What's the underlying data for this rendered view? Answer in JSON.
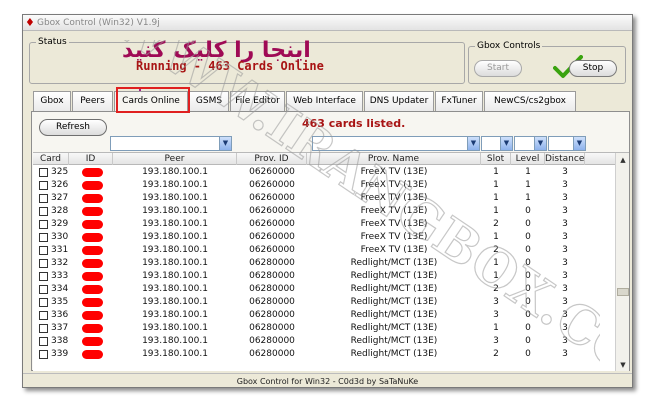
{
  "window": {
    "title": "Gbox Control (Win32) V1.9j"
  },
  "status_group": {
    "label": "Status",
    "running_text": "Running - 463 Cards Online"
  },
  "controls_group": {
    "label": "Gbox Controls",
    "start_label": "Start",
    "stop_label": "Stop"
  },
  "annotation": {
    "text": "اینجا را کلیک کنید"
  },
  "tabs": [
    {
      "label": "Gbox"
    },
    {
      "label": "Peers"
    },
    {
      "label": "Cards Online"
    },
    {
      "label": "GSMS"
    },
    {
      "label": "File Editor"
    },
    {
      "label": "Web Interface"
    },
    {
      "label": "DNS Updater"
    },
    {
      "label": "FxTuner"
    },
    {
      "label": "NewCS/cs2gbox"
    }
  ],
  "active_tab": "Cards Online",
  "cards_panel": {
    "refresh_label": "Refresh",
    "listed_text": "463 cards listed."
  },
  "table": {
    "columns": [
      "Card",
      "ID",
      "Peer",
      "Prov. ID",
      "Prov. Name",
      "Slot",
      "Level",
      "Distance"
    ],
    "rows": [
      [
        "325",
        "193.180.100.1",
        "06260000",
        "FreeX TV (13E)",
        "1",
        "1",
        "3"
      ],
      [
        "326",
        "193.180.100.1",
        "06260000",
        "FreeX TV (13E)",
        "1",
        "1",
        "3"
      ],
      [
        "327",
        "193.180.100.1",
        "06260000",
        "FreeX TV (13E)",
        "1",
        "1",
        "3"
      ],
      [
        "328",
        "193.180.100.1",
        "06260000",
        "FreeX TV (13E)",
        "1",
        "0",
        "3"
      ],
      [
        "329",
        "193.180.100.1",
        "06260000",
        "FreeX TV (13E)",
        "2",
        "0",
        "3"
      ],
      [
        "330",
        "193.180.100.1",
        "06260000",
        "FreeX TV (13E)",
        "1",
        "0",
        "3"
      ],
      [
        "331",
        "193.180.100.1",
        "06260000",
        "FreeX TV (13E)",
        "2",
        "0",
        "3"
      ],
      [
        "332",
        "193.180.100.1",
        "06280000",
        "Redlight/MCT (13E)",
        "1",
        "0",
        "3"
      ],
      [
        "333",
        "193.180.100.1",
        "06280000",
        "Redlight/MCT (13E)",
        "1",
        "0",
        "3"
      ],
      [
        "334",
        "193.180.100.1",
        "06280000",
        "Redlight/MCT (13E)",
        "2",
        "0",
        "3"
      ],
      [
        "335",
        "193.180.100.1",
        "06280000",
        "Redlight/MCT (13E)",
        "3",
        "0",
        "3"
      ],
      [
        "336",
        "193.180.100.1",
        "06280000",
        "Redlight/MCT (13E)",
        "3",
        "0",
        "3"
      ],
      [
        "337",
        "193.180.100.1",
        "06280000",
        "Redlight/MCT (13E)",
        "1",
        "0",
        "3"
      ],
      [
        "338",
        "193.180.100.1",
        "06280000",
        "Redlight/MCT (13E)",
        "3",
        "0",
        "3"
      ],
      [
        "339",
        "193.180.100.1",
        "06280000",
        "Redlight/MCT (13E)",
        "2",
        "0",
        "3"
      ]
    ]
  },
  "statusbar": {
    "text": "Gbox Control for Win32 - C0d3d by SaTaNuKe"
  },
  "watermark": {
    "text": "WWW.IRANGBOX.COM"
  },
  "colors": {
    "accent_red": "#a81414",
    "highlight_box": "#e02020",
    "annotation": "#9f0a55",
    "check_green": "#3aa30f",
    "id_mask": "#ff0000"
  },
  "icons": [
    "gbox-app-icon",
    "green-check-icon",
    "down-arrow-icon",
    "dropdown-arrow-icon",
    "scroll-up-icon",
    "scroll-down-icon"
  ]
}
